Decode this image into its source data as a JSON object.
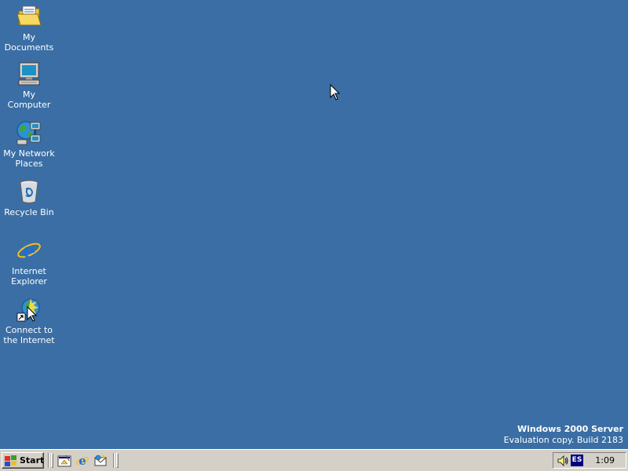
{
  "desktop": {
    "background_color": "#3a6ea5",
    "icons": [
      {
        "label": "My Documents",
        "icon": "folder-documents-icon"
      },
      {
        "label": "My Computer",
        "icon": "computer-icon"
      },
      {
        "label": "My Network Places",
        "icon": "network-icon"
      },
      {
        "label": "Recycle Bin",
        "icon": "recycle-bin-icon"
      },
      {
        "label": "Internet Explorer",
        "icon": "internet-explorer-icon"
      },
      {
        "label": "Connect to the Internet",
        "icon": "connect-internet-icon"
      }
    ],
    "watermark": {
      "title": "Windows 2000 Server",
      "subtitle": "Evaluation copy. Build 2183"
    }
  },
  "taskbar": {
    "start_label": "Start",
    "quick_launch": [
      {
        "icon": "show-desktop-icon"
      },
      {
        "icon": "internet-explorer-icon"
      },
      {
        "icon": "outlook-express-icon"
      }
    ],
    "tray": {
      "language": "ES",
      "clock": "1:09"
    }
  }
}
